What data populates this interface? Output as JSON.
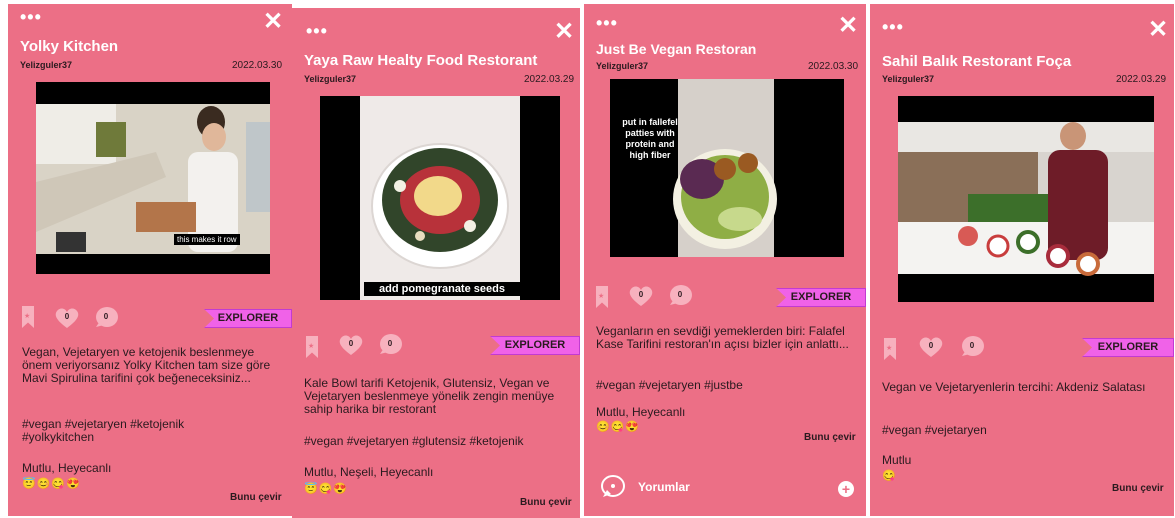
{
  "cards": [
    {
      "title": "Yolky Kitchen",
      "user": "Yelizguler37",
      "date": "2022.03.30",
      "media_caption": "this makes it row",
      "likes": "0",
      "comments": "0",
      "explorer": "EXPLORER",
      "description": "Vegan, Vejetaryen ve ketojenik beslenmeye önem veriyorsanız Yolky Kitchen tam size göre Mavi Spirulina tarifini çok beğeneceksiniz...",
      "tags": "#vegan #vejetaryen #ketojenik #yolkykitchen",
      "mood": "Mutlu, Heyecanlı",
      "emojis": "😇😊😋😍",
      "translate": "Bunu çevir"
    },
    {
      "title": "Yaya Raw Healty Food Restorant",
      "user": "Yelizguler37",
      "date": "2022.03.29",
      "media_caption": "add pomegranate seeds",
      "likes": "0",
      "comments": "0",
      "explorer": "EXPLORER",
      "description": "Kale Bowl tarifi Ketojenik, Glutensiz, Vegan ve Vejetaryen beslenmeye yönelik zengin menüye sahip harika bir restorant",
      "tags": "#vegan #vejetaryen #glutensiz #ketojenik",
      "mood": "Mutlu, Neşeli, Heyecanlı",
      "emojis": "😇😋😍",
      "translate": "Bunu çevir"
    },
    {
      "title": "Just Be Vegan Restoran",
      "user": "Yelizguler37",
      "date": "2022.03.30",
      "media_caption": "put in fallefel patties with protein and high fiber",
      "likes": "0",
      "comments": "0",
      "explorer": "EXPLORER",
      "description": "Veganların en sevdiği yemeklerden biri: Falafel Kase Tarifini restoran'ın açısı bizler için anlattı...",
      "tags": "#vegan #vejetaryen #justbe",
      "mood": "Mutlu, Heyecanlı",
      "emojis": "😊😋😍",
      "translate": "Bunu çevir",
      "comments_label": "Yorumlar"
    },
    {
      "title": "Sahil Balık Restorant Foça",
      "user": "Yelizguler37",
      "date": "2022.03.29",
      "likes": "0",
      "comments": "0",
      "explorer": "EXPLORER",
      "description": "Vegan ve Vejetaryenlerin tercihi: Akdeniz Salatası",
      "tags": "#vegan #vejetaryen",
      "mood": "Mutlu",
      "emojis": "😋",
      "translate": "Bunu çevir"
    }
  ],
  "colors": {
    "card_bg": "#ec6f86",
    "explorer_bg": "#f062e8",
    "icon_fill": "#f7b1be"
  },
  "icons": {
    "menu": "more-dots-icon",
    "close": "close-x-icon",
    "save": "bookmark-icon",
    "like": "heart-icon",
    "comment": "speech-bubble-icon",
    "add": "plus-circle-icon"
  }
}
